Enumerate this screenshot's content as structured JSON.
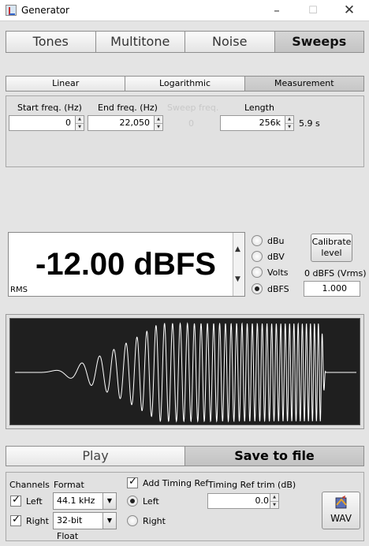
{
  "window": {
    "title": "Generator",
    "minimize": "–",
    "maximize": "☐",
    "close": "✕"
  },
  "main_tabs": [
    {
      "label": "Tones",
      "active": false
    },
    {
      "label": "Multitone",
      "active": false
    },
    {
      "label": "Noise",
      "active": false
    },
    {
      "label": "Sweeps",
      "active": true
    }
  ],
  "sweep_tabs": [
    {
      "label": "Linear",
      "active": false
    },
    {
      "label": "Logarithmic",
      "active": false
    },
    {
      "label": "Measurement",
      "active": true
    }
  ],
  "params": {
    "start_freq_label": "Start freq. (Hz)",
    "start_freq_value": "0",
    "end_freq_label": "End freq. (Hz)",
    "end_freq_value": "22,050",
    "sweep_freq_label": "Sweep freq.",
    "sweep_freq_value": "0",
    "length_label": "Length",
    "length_value": "256k",
    "length_seconds": "5.9 s"
  },
  "level": {
    "value": "-12.00 dBFS",
    "mode": "RMS",
    "units": [
      {
        "label": "dBu",
        "selected": false
      },
      {
        "label": "dBV",
        "selected": false
      },
      {
        "label": "Volts",
        "selected": false
      },
      {
        "label": "dBFS",
        "selected": true
      }
    ],
    "calibrate_label_line1": "Calibrate",
    "calibrate_label_line2": "level",
    "dbfs_vrms_label": "0 dBFS (Vrms)",
    "dbfs_vrms_value": "1.000"
  },
  "waveform": {
    "description_type": "swept sine, rising frequency, fade-in envelope",
    "trace_color": "#ffffff",
    "background_color": "#1f1f1f"
  },
  "actions": {
    "play_label": "Play",
    "save_label": "Save to file"
  },
  "output": {
    "channels_label": "Channels",
    "left_label": "Left",
    "left_checked": true,
    "right_label": "Right",
    "right_checked": true,
    "format_label": "Format",
    "sample_rate": "44.1 kHz",
    "bit_depth": "32-bit Float",
    "timing_ref_label": "Add Timing Ref",
    "timing_ref_checked": true,
    "timing_left_label": "Left",
    "timing_left_selected": true,
    "timing_right_label": "Right",
    "timing_right_selected": false,
    "trim_label": "Timing Ref trim (dB)",
    "trim_value": "0.0",
    "wav_label": "WAV"
  }
}
